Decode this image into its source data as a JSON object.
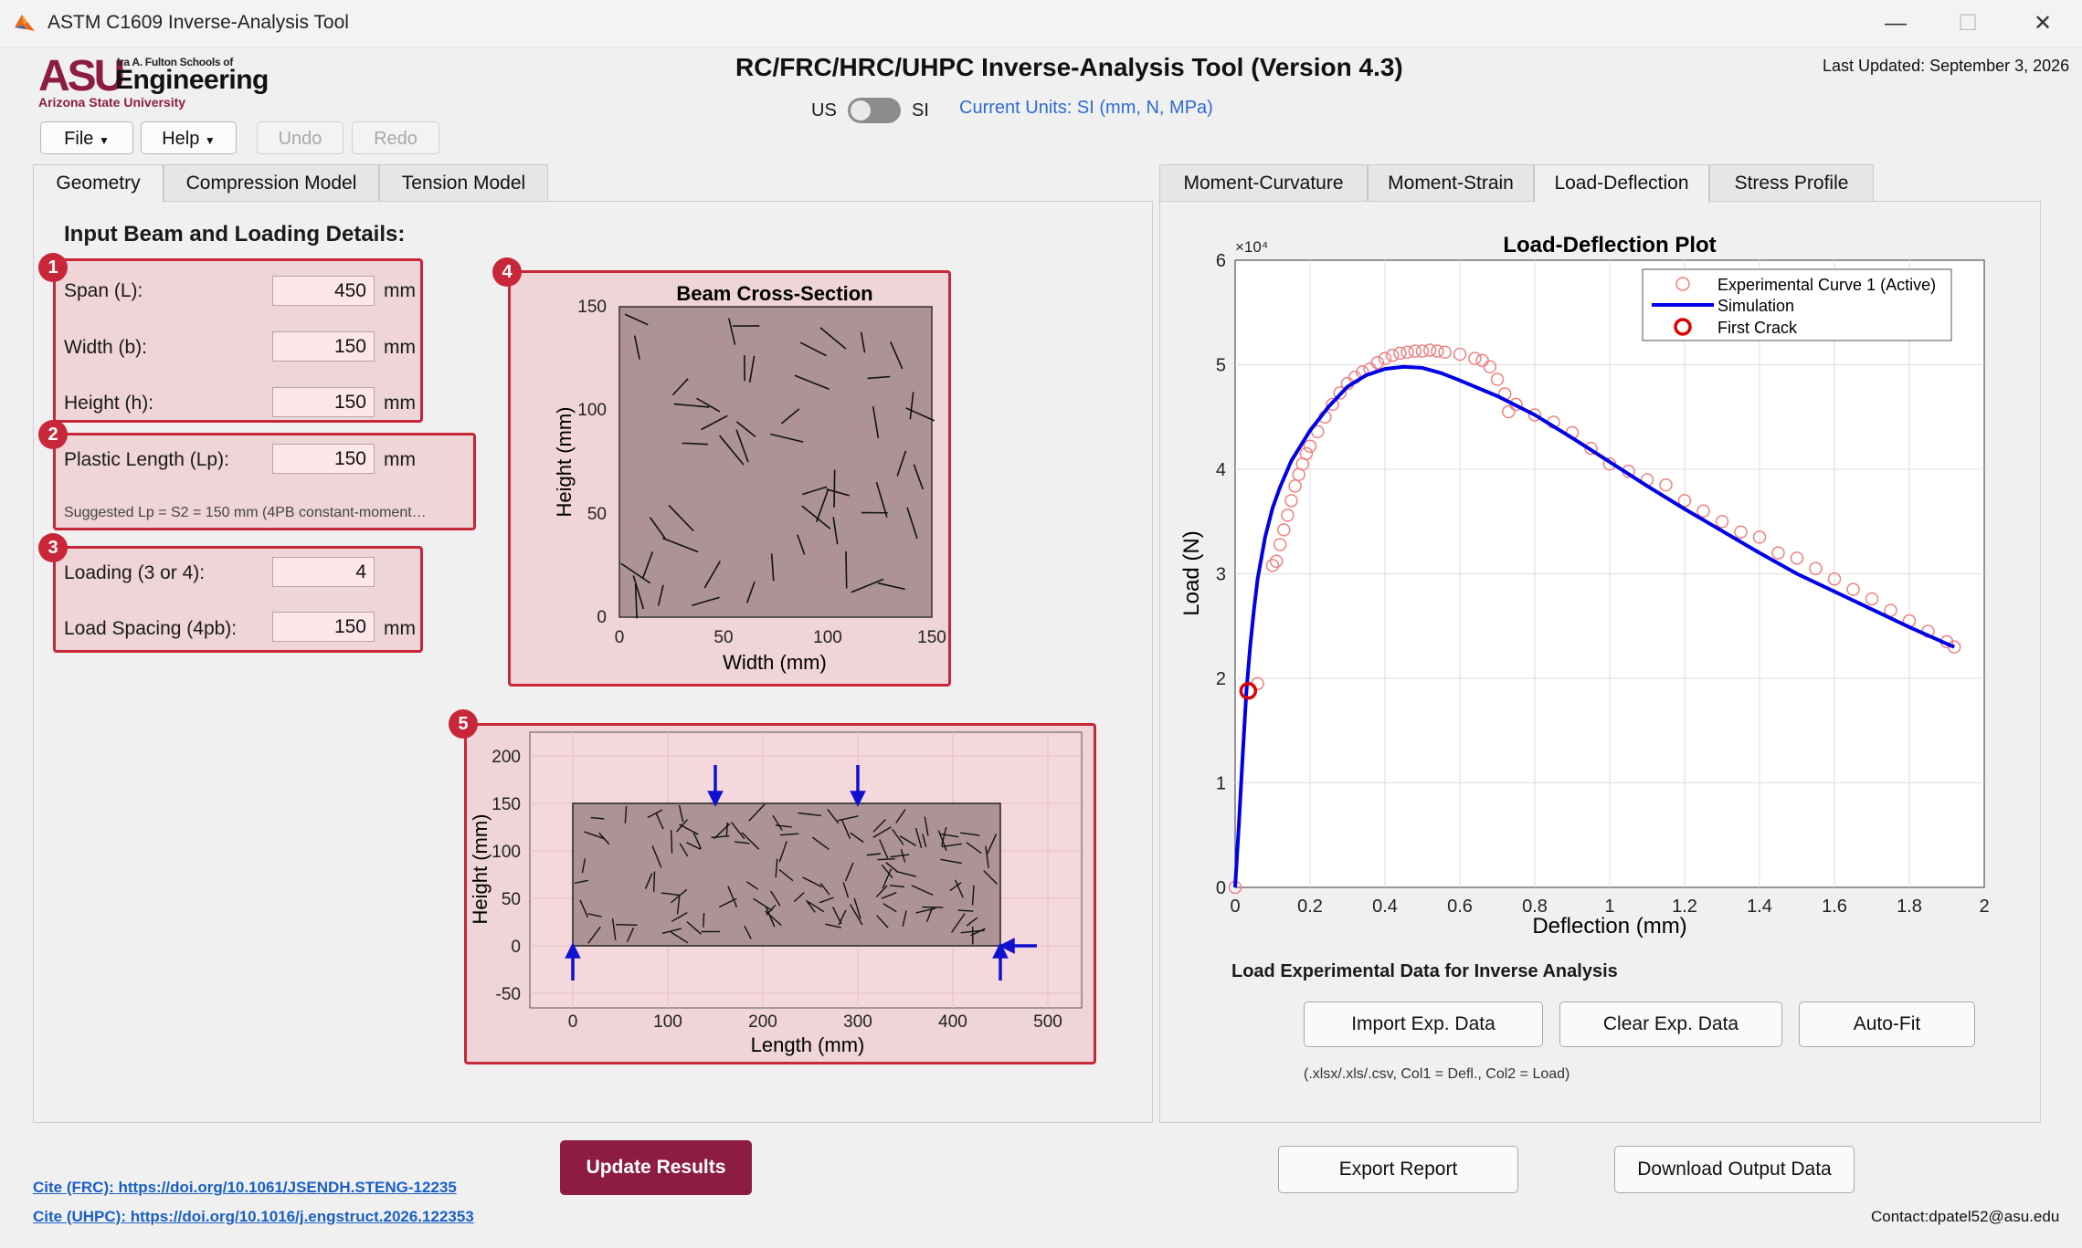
{
  "window": {
    "title": "ASTM C1609 Inverse-Analysis Tool"
  },
  "logo": {
    "asu": "ASU",
    "school": "Ira A. Fulton Schools of",
    "engineering": "Engineering",
    "university": "Arizona State University"
  },
  "header": {
    "app_title": "RC/FRC/HRC/UHPC Inverse-Analysis Tool (Version 4.3)",
    "last_updated": "Last Updated: September 3, 2026",
    "units_us": "US",
    "units_si": "SI",
    "current_units": "Current Units: SI (mm, N, MPa)"
  },
  "toolbar": {
    "file": "File",
    "help": "Help",
    "undo": "Undo",
    "redo": "Redo"
  },
  "left_tabs": [
    "Geometry",
    "Compression Model",
    "Tension Model"
  ],
  "right_tabs": [
    "Moment-Curvature",
    "Moment-Strain",
    "Load-Deflection",
    "Stress Profile"
  ],
  "geometry": {
    "heading": "Input Beam and Loading Details:",
    "badges": [
      "1",
      "2",
      "3",
      "4",
      "5"
    ],
    "span": {
      "label": "Span (L):",
      "value": "450",
      "unit": "mm"
    },
    "width": {
      "label": "Width (b):",
      "value": "150",
      "unit": "mm"
    },
    "height": {
      "label": "Height (h):",
      "value": "150",
      "unit": "mm"
    },
    "plastic": {
      "label": "Plastic Length (Lp):",
      "value": "150",
      "unit": "mm",
      "hint": "Suggested Lp = S2 = 150 mm (4PB constant-moment…"
    },
    "loading": {
      "label": "Loading (3 or 4):",
      "value": "4"
    },
    "spacing": {
      "label": "Load Spacing (4pb):",
      "value": "150",
      "unit": "mm"
    }
  },
  "cross_section": {
    "title": "Beam Cross-Section",
    "xlabel": "Width (mm)",
    "ylabel": "Height (mm)",
    "xticks": [
      "0",
      "50",
      "100",
      "150"
    ],
    "yticks": [
      "0",
      "50",
      "100",
      "150"
    ]
  },
  "elevation": {
    "xlabel": "Length (mm)",
    "ylabel": "Height (mm)",
    "xticks": [
      "0",
      "100",
      "200",
      "300",
      "400",
      "500"
    ],
    "yticks": [
      "200",
      "150",
      "100",
      "50",
      "0",
      "-50"
    ]
  },
  "colors": {
    "accent": "#8c1d40",
    "badge": "#c8273a",
    "sim": "#0000e6",
    "exp": "#f08080",
    "link": "#1a5fc4"
  },
  "chart_data": {
    "type": "line",
    "title": "Load-Deflection Plot",
    "xlabel": "Deflection (mm)",
    "ylabel": "Load (N)",
    "y_multiplier": "×10⁴",
    "xlim": [
      0,
      2
    ],
    "ylim": [
      0,
      60000
    ],
    "xticks": [
      "0",
      "0.2",
      "0.4",
      "0.6",
      "0.8",
      "1",
      "1.2",
      "1.4",
      "1.6",
      "1.8",
      "2"
    ],
    "yticks": [
      "0",
      "1",
      "2",
      "3",
      "4",
      "5",
      "6"
    ],
    "grid": true,
    "legend_position": "top-right",
    "legend": [
      "Experimental Curve 1 (Active)",
      "Simulation",
      "First Crack"
    ],
    "series": [
      {
        "name": "Experimental Curve 1 (Active)",
        "style": "circles",
        "x": [
          0.0,
          0.06,
          0.1,
          0.11,
          0.12,
          0.13,
          0.14,
          0.15,
          0.16,
          0.17,
          0.18,
          0.19,
          0.2,
          0.22,
          0.24,
          0.26,
          0.28,
          0.3,
          0.32,
          0.34,
          0.36,
          0.38,
          0.4,
          0.42,
          0.44,
          0.46,
          0.48,
          0.5,
          0.52,
          0.54,
          0.56,
          0.6,
          0.64,
          0.66,
          0.68,
          0.7,
          0.72,
          0.73,
          0.75,
          0.8,
          0.85,
          0.9,
          0.95,
          1.0,
          1.05,
          1.1,
          1.15,
          1.2,
          1.25,
          1.3,
          1.35,
          1.4,
          1.45,
          1.5,
          1.55,
          1.6,
          1.65,
          1.7,
          1.75,
          1.8,
          1.85,
          1.9,
          1.92
        ],
        "y": [
          0,
          19500,
          30800,
          31200,
          32800,
          34200,
          35600,
          37000,
          38400,
          39500,
          40500,
          41500,
          42200,
          43600,
          45000,
          46200,
          47300,
          48200,
          48800,
          49300,
          49600,
          50200,
          50600,
          50900,
          51100,
          51200,
          51300,
          51300,
          51400,
          51300,
          51200,
          51000,
          50600,
          50400,
          49800,
          48600,
          47200,
          45500,
          46200,
          45200,
          44500,
          43500,
          42000,
          40500,
          39800,
          39000,
          38500,
          37000,
          36000,
          35000,
          34000,
          33500,
          32000,
          31500,
          30500,
          29500,
          28500,
          27600,
          26500,
          25500,
          24500,
          23500,
          23000
        ]
      },
      {
        "name": "Simulation",
        "style": "line",
        "x": [
          0.0,
          0.01,
          0.02,
          0.03,
          0.04,
          0.05,
          0.06,
          0.08,
          0.1,
          0.12,
          0.15,
          0.2,
          0.25,
          0.3,
          0.35,
          0.4,
          0.45,
          0.5,
          0.55,
          0.6,
          0.7,
          0.8,
          0.9,
          1.0,
          1.1,
          1.2,
          1.3,
          1.4,
          1.5,
          1.6,
          1.7,
          1.8,
          1.9,
          1.92
        ],
        "y": [
          0,
          6000,
          12500,
          18700,
          23000,
          26500,
          29500,
          33500,
          36300,
          38300,
          40800,
          43700,
          46000,
          47900,
          49000,
          49600,
          49800,
          49700,
          49200,
          48500,
          47000,
          45200,
          43000,
          40700,
          38400,
          36200,
          34100,
          32000,
          30000,
          28300,
          26600,
          24900,
          23300,
          23000
        ]
      }
    ],
    "first_crack": {
      "x": 0.035,
      "y": 18800
    }
  },
  "load_exp": {
    "heading": "Load Experimental Data for Inverse Analysis",
    "import": "Import Exp. Data",
    "clear": "Clear Exp. Data",
    "autofit": "Auto-Fit",
    "hint": "(.xlsx/.xls/.csv, Col1 = Defl., Col2 = Load)"
  },
  "footer": {
    "update": "Update Results",
    "export": "Export Report",
    "download": "Download Output Data",
    "cite_frc": "Cite (FRC): https://doi.org/10.1061/JSENDH.STENG-12235",
    "cite_uhpc": "Cite (UHPC): https://doi.org/10.1016/j.engstruct.2026.122353",
    "contact": "Contact:dpatel52@asu.edu"
  }
}
